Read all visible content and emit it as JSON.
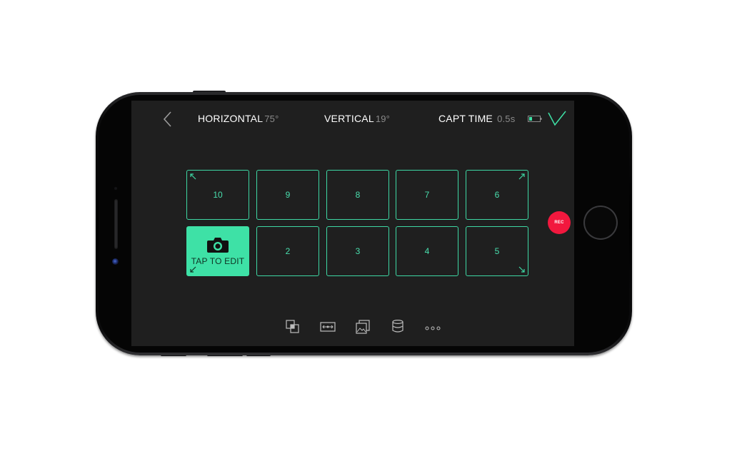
{
  "header": {
    "horizontal_label": "HORIZONTAL",
    "horizontal_value": "75°",
    "vertical_label": "VERTICAL",
    "vertical_value": "19°",
    "capt_time_label": "CAPT TIME",
    "capt_time_value": "0.5s"
  },
  "grid": {
    "top_row": [
      "10",
      "9",
      "8",
      "7",
      "6"
    ],
    "bottom_row": [
      "2",
      "3",
      "4",
      "5"
    ],
    "active_tile_label": "TAP TO EDIT"
  },
  "rec_label": "REC",
  "toolbar": {
    "icons": [
      "layers-icon",
      "pan-range-icon",
      "photo-stack-icon",
      "lens-icon",
      "more-icon"
    ],
    "more_label": "ooo"
  },
  "colors": {
    "accent": "#3ee1a6",
    "record": "#f2183e",
    "screen_bg": "#1f1f1f"
  }
}
